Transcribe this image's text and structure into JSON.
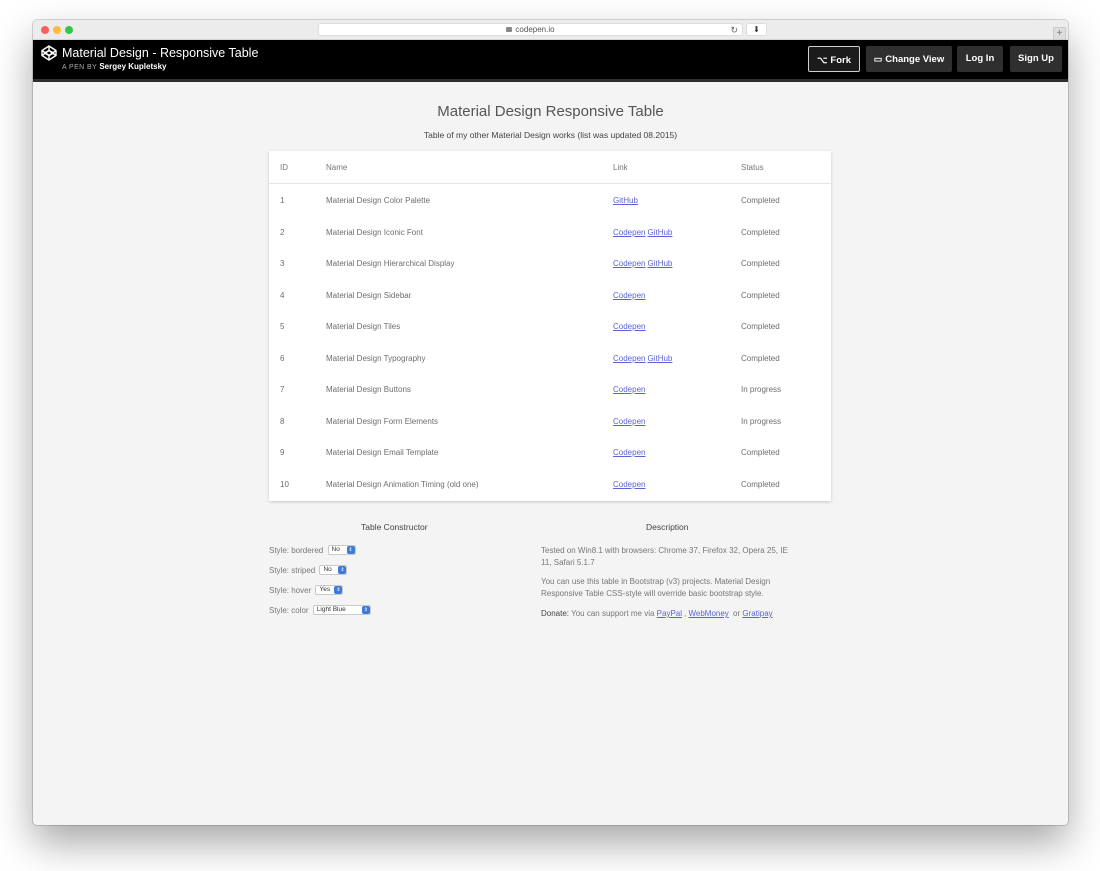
{
  "browser": {
    "url": "codepen.io"
  },
  "header": {
    "title": "Material Design - Responsive Table",
    "byline_prefix": "A PEN BY",
    "author": "Sergey Kupletsky",
    "buttons": {
      "fork": "Fork",
      "change_view": "Change View",
      "login": "Log In",
      "signup": "Sign Up"
    }
  },
  "main": {
    "title": "Material Design Responsive Table",
    "subtitle": "Table of my other Material Design works (list was updated 08.2015)",
    "table": {
      "headers": [
        "ID",
        "Name",
        "Link",
        "Status"
      ],
      "rows": [
        {
          "id": "1",
          "name": "Material Design Color Palette",
          "links": [
            "GitHub"
          ],
          "status": "Completed"
        },
        {
          "id": "2",
          "name": "Material Design Iconic Font",
          "links": [
            "Codepen",
            "GitHub"
          ],
          "status": "Completed"
        },
        {
          "id": "3",
          "name": "Material Design Hierarchical Display",
          "links": [
            "Codepen",
            "GitHub"
          ],
          "status": "Completed"
        },
        {
          "id": "4",
          "name": "Material Design Sidebar",
          "links": [
            "Codepen"
          ],
          "status": "Completed"
        },
        {
          "id": "5",
          "name": "Material Design Tiles",
          "links": [
            "Codepen"
          ],
          "status": "Completed"
        },
        {
          "id": "6",
          "name": "Material Design Typography",
          "links": [
            "Codepen",
            "GitHub"
          ],
          "status": "Completed"
        },
        {
          "id": "7",
          "name": "Material Design Buttons",
          "links": [
            "Codepen"
          ],
          "status": "In progress"
        },
        {
          "id": "8",
          "name": "Material Design Form Elements",
          "links": [
            "Codepen"
          ],
          "status": "In progress"
        },
        {
          "id": "9",
          "name": "Material Design Email Template",
          "links": [
            "Codepen"
          ],
          "status": "Completed"
        },
        {
          "id": "10",
          "name": "Material Design Animation Timing (old one)",
          "links": [
            "Codepen"
          ],
          "status": "Completed"
        }
      ]
    }
  },
  "constructor": {
    "title": "Table Constructor",
    "options": [
      {
        "label": "Style: bordered",
        "value": "No"
      },
      {
        "label": "Style: striped",
        "value": "No"
      },
      {
        "label": "Style: hover",
        "value": "Yes"
      },
      {
        "label": "Style: color",
        "value": "Light Blue"
      }
    ]
  },
  "description": {
    "title": "Description",
    "p1": "Tested on Win8.1 with browsers: Chrome 37, Firefox 32, Opera 25, IE 11, Safari 5.1.7",
    "p2": "You can use this table in Bootstrap (v3) projects. Material Design Responsive Table CSS-style will override basic bootstrap style.",
    "donate_label": "Donate:",
    "donate_text": "You can support me via",
    "donate_links": [
      "PayPal",
      "WebMoney",
      "Gratipay"
    ],
    "donate_sep": ",",
    "donate_or": "or"
  },
  "colors": {
    "header_bg": "#000000",
    "link": "#5b63d6",
    "page_bg": "#f4f4f4"
  }
}
